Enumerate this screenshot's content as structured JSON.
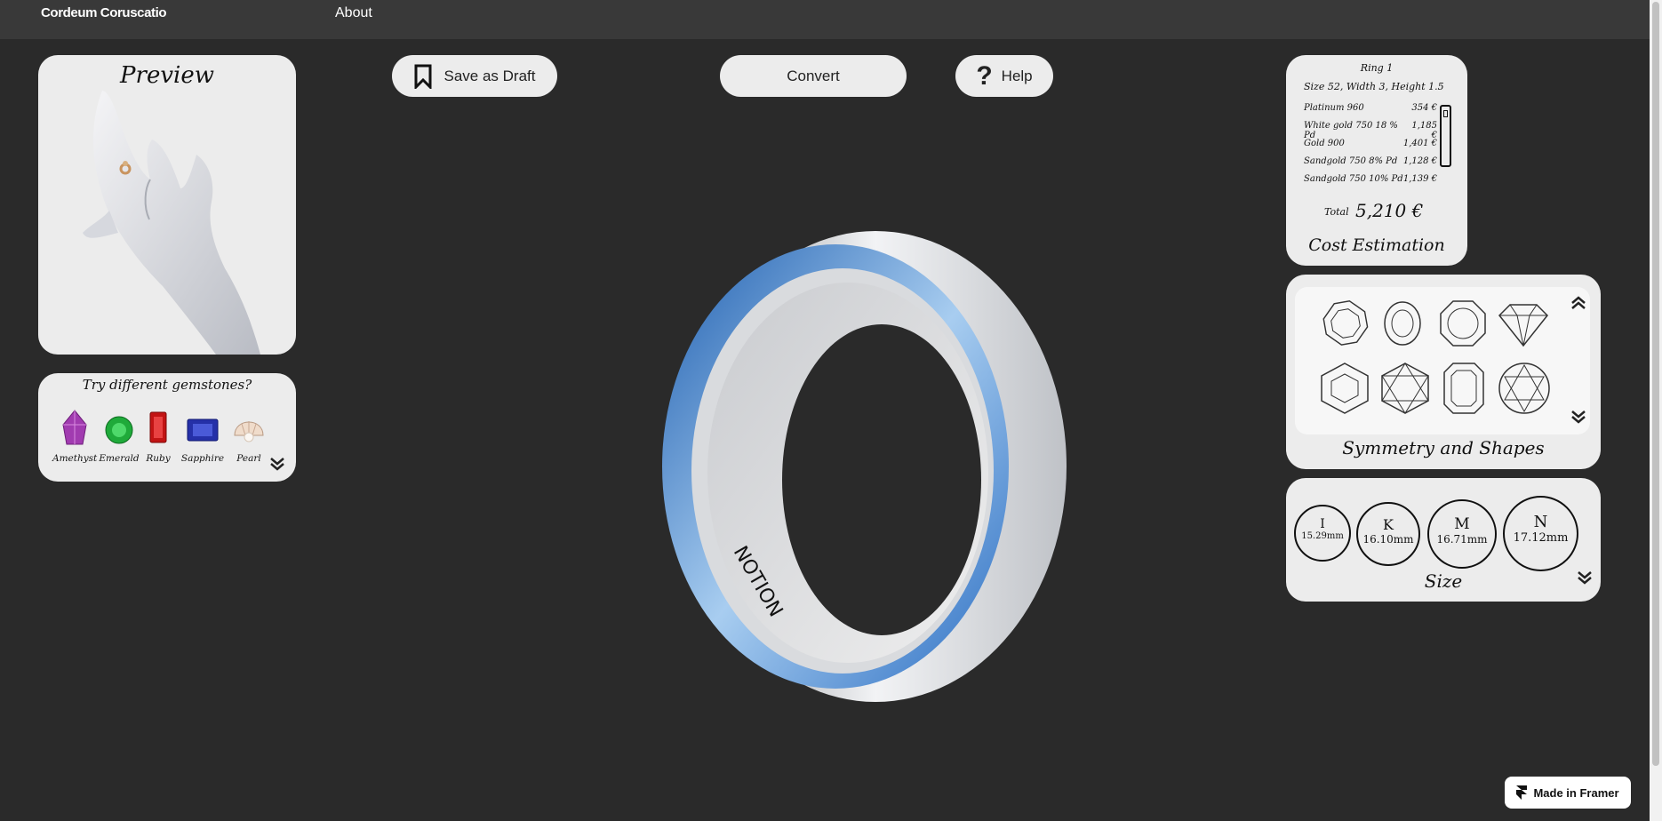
{
  "header": {
    "brand": "Cordeum Coruscatio",
    "nav_about": "About"
  },
  "toolbar": {
    "save_draft": "Save as Draft",
    "convert": "Convert",
    "help": "Help"
  },
  "preview": {
    "title": "Preview"
  },
  "gemstones": {
    "title": "Try different gemstones?",
    "items": [
      {
        "label": "Amethyst",
        "color": "#a13bb0"
      },
      {
        "label": "Emerald",
        "color": "#1faa3a"
      },
      {
        "label": "Ruby",
        "color": "#c21414"
      },
      {
        "label": "Sapphire",
        "color": "#2530a8"
      },
      {
        "label": "Pearl",
        "color": "#f0e4d8"
      }
    ]
  },
  "cost": {
    "ring_name": "Ring 1",
    "spec": "Size 52, Width 3, Height 1.5",
    "rows": [
      {
        "material": "Platinum 960",
        "price": "354 €"
      },
      {
        "material": "White gold 750 18 % Pd",
        "price": "1,185 €"
      },
      {
        "material": "Gold 900",
        "price": "1,401 €"
      },
      {
        "material": "Sandgold 750 8% Pd",
        "price": "1,128 €"
      },
      {
        "material": "Sandgold 750 10% Pd",
        "price": "1,139 €"
      }
    ],
    "total_label": "Total",
    "total_value": "5,210 €",
    "footer": "Cost Estimation"
  },
  "shapes": {
    "title": "Symmetry and Shapes"
  },
  "size": {
    "title": "Size",
    "options": [
      {
        "letter": "I",
        "mm": "15.29mm"
      },
      {
        "letter": "K",
        "mm": "16.10mm"
      },
      {
        "letter": "M",
        "mm": "16.71mm"
      },
      {
        "letter": "N",
        "mm": "17.12mm"
      }
    ]
  },
  "ring": {
    "engraving": "NOTION"
  },
  "framer": {
    "label": "Made in Framer"
  }
}
